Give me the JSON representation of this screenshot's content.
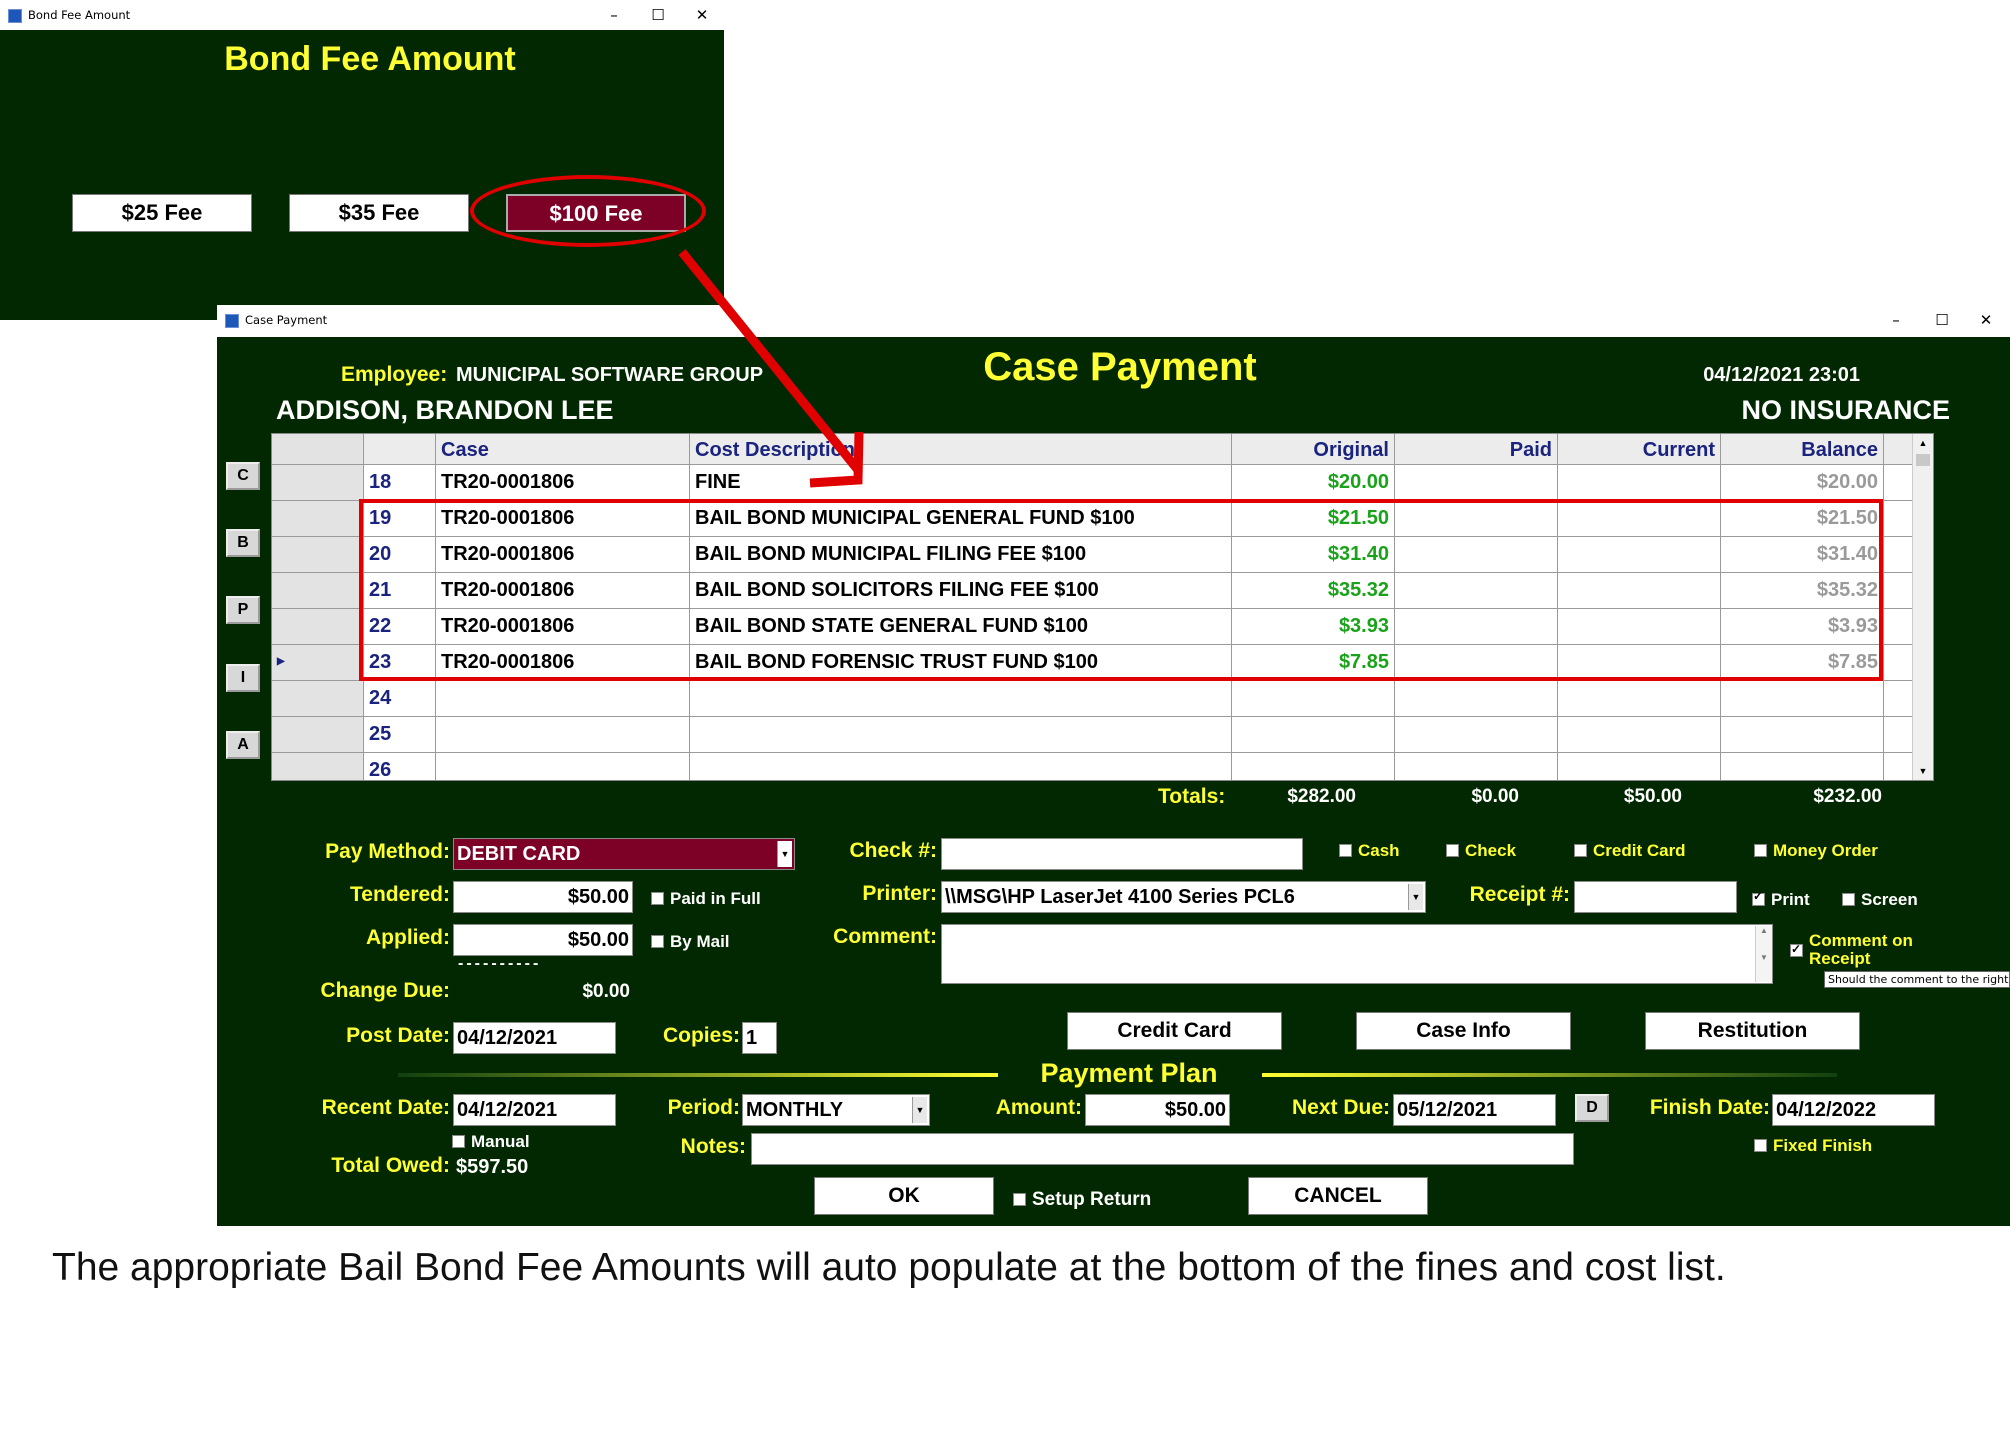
{
  "bond_window": {
    "title": "Bond Fee Amount",
    "heading": "Bond Fee Amount",
    "buttons": [
      "$25 Fee",
      "$35 Fee",
      "$100 Fee"
    ],
    "selected_button": "$100 Fee"
  },
  "case_window": {
    "title": "Case Payment",
    "heading": "Case Payment",
    "employee_label": "Employee:",
    "employee": "MUNICIPAL SOFTWARE GROUP",
    "defendant": "ADDISON, BRANDON LEE",
    "datetime": "04/12/2021 23:01",
    "insurance": "NO INSURANCE",
    "side_buttons": [
      "C",
      "B",
      "P",
      "I",
      "A"
    ],
    "grid": {
      "headers": [
        "Case",
        "Cost Description",
        "Original",
        "Paid",
        "Current",
        "Balance"
      ],
      "rows": [
        {
          "no": "18",
          "case": "TR20-0001806",
          "desc": "FINE",
          "original": "$20.00",
          "paid": "",
          "current": "",
          "balance": "$20.00"
        },
        {
          "no": "19",
          "case": "TR20-0001806",
          "desc": "BAIL BOND MUNICIPAL GENERAL FUND $100",
          "original": "$21.50",
          "paid": "",
          "current": "",
          "balance": "$21.50"
        },
        {
          "no": "20",
          "case": "TR20-0001806",
          "desc": "BAIL BOND MUNICIPAL FILING FEE $100",
          "original": "$31.40",
          "paid": "",
          "current": "",
          "balance": "$31.40"
        },
        {
          "no": "21",
          "case": "TR20-0001806",
          "desc": "BAIL BOND SOLICITORS FILING FEE $100",
          "original": "$35.32",
          "paid": "",
          "current": "",
          "balance": "$35.32"
        },
        {
          "no": "22",
          "case": "TR20-0001806",
          "desc": "BAIL BOND STATE GENERAL FUND $100",
          "original": "$3.93",
          "paid": "",
          "current": "",
          "balance": "$3.93"
        },
        {
          "no": "23",
          "case": "TR20-0001806",
          "desc": "BAIL BOND FORENSIC TRUST FUND $100",
          "original": "$7.85",
          "paid": "",
          "current": "",
          "balance": "$7.85"
        },
        {
          "no": "24",
          "case": "",
          "desc": "",
          "original": "",
          "paid": "",
          "current": "",
          "balance": ""
        },
        {
          "no": "25",
          "case": "",
          "desc": "",
          "original": "",
          "paid": "",
          "current": "",
          "balance": ""
        },
        {
          "no": "26",
          "case": "",
          "desc": "",
          "original": "",
          "paid": "",
          "current": "",
          "balance": ""
        }
      ],
      "current_row_marker": "23"
    },
    "totals": {
      "label": "Totals:",
      "original": "$282.00",
      "paid": "$0.00",
      "current": "$50.00",
      "balance": "$232.00"
    },
    "pay_method": {
      "label": "Pay Method:",
      "value": "DEBIT CARD"
    },
    "tendered": {
      "label": "Tendered:",
      "value": "$50.00"
    },
    "applied": {
      "label": "Applied:",
      "value": "$50.00"
    },
    "dashes": "----------",
    "change_due": {
      "label": "Change Due:",
      "value": "$0.00"
    },
    "post_date": {
      "label": "Post Date:",
      "value": "04/12/2021"
    },
    "copies": {
      "label": "Copies:",
      "value": "1"
    },
    "check_no": {
      "label": "Check #:",
      "value": ""
    },
    "printer": {
      "label": "Printer:",
      "value": "\\\\MSG\\HP LaserJet 4100 Series PCL6"
    },
    "receipt_no": {
      "label": "Receipt #:",
      "value": ""
    },
    "comment": {
      "label": "Comment:",
      "value": ""
    },
    "checkboxes": {
      "paid_in_full": "Paid in Full",
      "by_mail": "By Mail",
      "cash": "Cash",
      "check": "Check",
      "credit_card": "Credit Card",
      "money_order": "Money Order",
      "print": "Print",
      "screen": "Screen",
      "comment_on_receipt_1": "Comment on",
      "comment_on_receipt_2": "Receipt",
      "manual": "Manual",
      "fixed_finish": "Fixed Finish",
      "setup_return": "Setup Return"
    },
    "tooltip": "Should the comment to the right b",
    "action_buttons": {
      "credit_card": "Credit Card",
      "case_info": "Case Info",
      "restitution": "Restitution"
    },
    "payment_plan": {
      "heading": "Payment Plan",
      "recent_date_label": "Recent Date:",
      "recent_date": "04/12/2021",
      "period_label": "Period:",
      "period": "MONTHLY",
      "amount_label": "Amount:",
      "amount": "$50.00",
      "next_due_label": "Next Due:",
      "next_due": "05/12/2021",
      "d_button": "D",
      "finish_date_label": "Finish Date:",
      "finish_date": "04/12/2022",
      "notes_label": "Notes:",
      "notes": "",
      "total_owed_label": "Total Owed:",
      "total_owed": "$597.50"
    },
    "ok": "OK",
    "cancel": "CANCEL"
  },
  "caption": "The appropriate Bail Bond Fee Amounts will auto populate at the bottom of the fines and cost list.",
  "colors": {
    "window_bg": "#012800",
    "label_yellow": "#ffff33",
    "accent_maroon": "#7d0026",
    "annotation_red": "#e00000",
    "original_green": "#1aa31a",
    "balance_gray": "#9a9a9a",
    "header_navy": "#1a237e"
  }
}
